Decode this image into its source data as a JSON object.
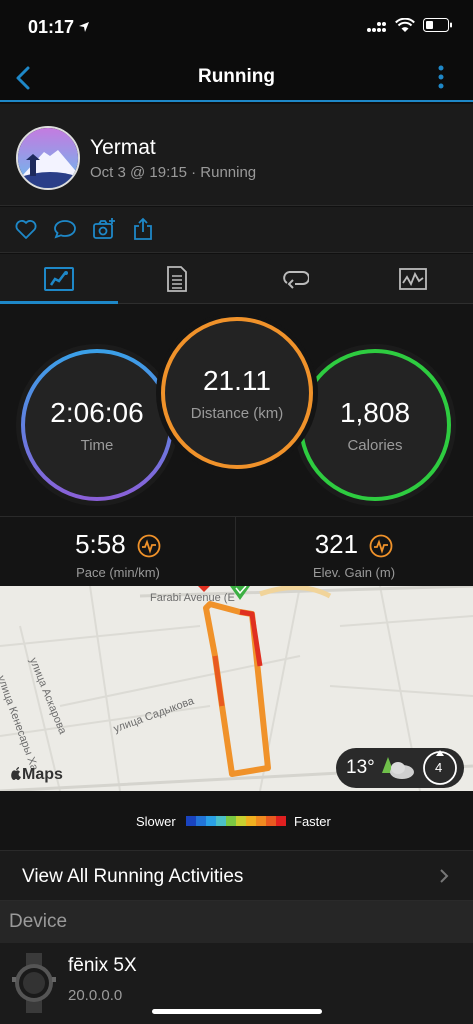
{
  "status": {
    "time": "01:17"
  },
  "nav": {
    "title": "Running"
  },
  "user": {
    "name": "Yermat",
    "subtitle": "Oct 3 @ 19:15 · Running"
  },
  "stats": {
    "time": {
      "value": "2:06:06",
      "label": "Time"
    },
    "distance": {
      "value": "21.11",
      "label": "Distance (km)"
    },
    "calories": {
      "value": "1,808",
      "label": "Calories"
    }
  },
  "metrics": {
    "pace": {
      "value": "5:58",
      "label": "Pace (min/km)"
    },
    "elevation": {
      "value": "321",
      "label": "Elev. Gain (m)"
    }
  },
  "map": {
    "street_top": "Farabi Avenue (E",
    "street_1": "улица Аскарова",
    "street_2": "улица Садыкова",
    "street_3": "улица Кенесары Ха",
    "logo": "Maps",
    "weather_temp": "13°",
    "wind": "4"
  },
  "legend": {
    "slower": "Slower",
    "faster": "Faster",
    "colors": [
      "#1a44c0",
      "#2274d8",
      "#2aa0e6",
      "#4bc0c8",
      "#7ac843",
      "#c8d030",
      "#f0b020",
      "#f08a20",
      "#e85a20",
      "#e02020"
    ]
  },
  "view_all": {
    "label": "View All Running Activities"
  },
  "device": {
    "header": "Device",
    "name": "fēnix 5X",
    "version": "20.0.0.0"
  },
  "colors": {
    "accent": "#1e88c8",
    "time_ring": "#5b6fe0",
    "distance_ring": "#f0922a",
    "calories_ring": "#2ecc40",
    "icon_orange": "#f0922a"
  }
}
